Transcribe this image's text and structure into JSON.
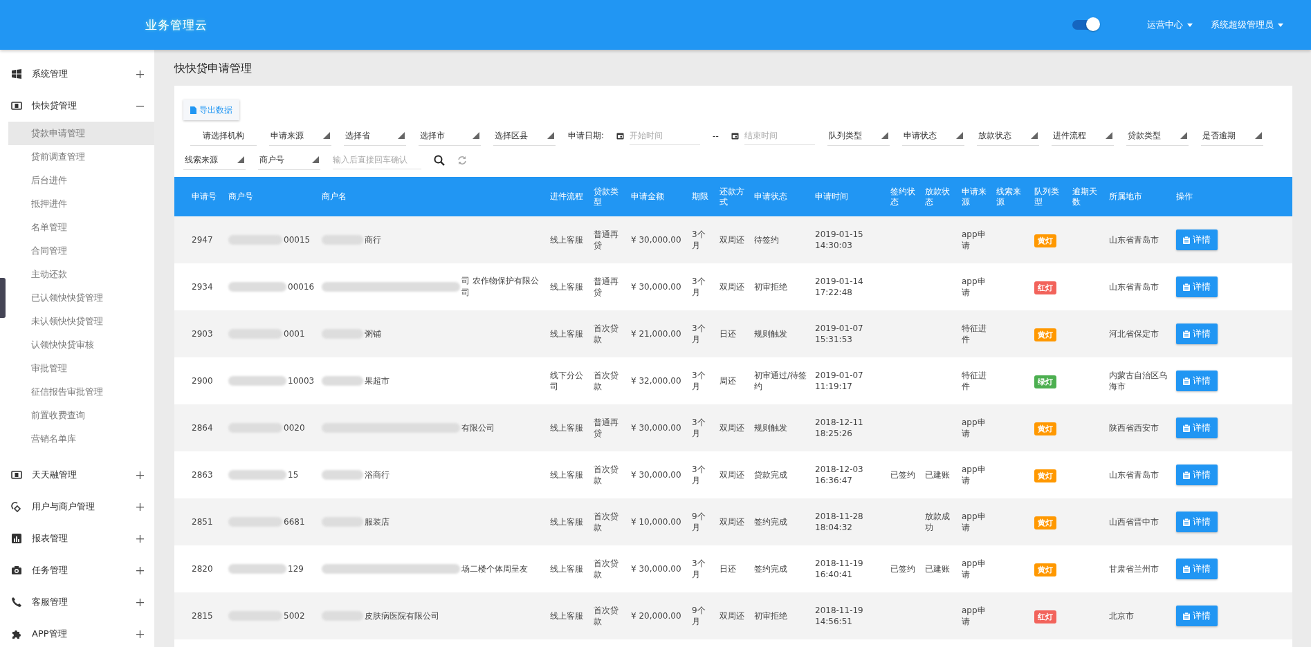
{
  "header": {
    "logo": "业务管理云",
    "toggle": {
      "on": true
    },
    "menus": [
      {
        "label": "运营中心"
      },
      {
        "label": "系统超级管理员"
      }
    ]
  },
  "sidebar": {
    "groups": [
      {
        "label": "系统管理",
        "expanded": false
      },
      {
        "label": "快快贷管理",
        "expanded": true,
        "children": [
          {
            "label": "贷款申请管理",
            "selected": true
          },
          {
            "label": "贷前调查管理",
            "selected": false
          },
          {
            "label": "后台进件",
            "selected": false
          },
          {
            "label": "抵押进件",
            "selected": false
          },
          {
            "label": "名单管理",
            "selected": false
          },
          {
            "label": "合同管理",
            "selected": false
          },
          {
            "label": "主动还款",
            "selected": false
          },
          {
            "label": "已认领快快贷管理",
            "selected": false
          },
          {
            "label": "未认领快快贷管理",
            "selected": false
          },
          {
            "label": "认领快快贷审核",
            "selected": false
          },
          {
            "label": "审批管理",
            "selected": false
          },
          {
            "label": "征信报告审批管理",
            "selected": false
          },
          {
            "label": "前置收费查询",
            "selected": false
          },
          {
            "label": "营销名单库",
            "selected": false
          }
        ]
      },
      {
        "label": "天天融管理",
        "expanded": false
      },
      {
        "label": "用户与商户管理",
        "expanded": false
      },
      {
        "label": "报表管理",
        "expanded": false
      },
      {
        "label": "任务管理",
        "expanded": false
      },
      {
        "label": "客服管理",
        "expanded": false
      },
      {
        "label": "APP管理",
        "expanded": false
      }
    ]
  },
  "page_title": "快快贷申请管理",
  "export_button": "导出数据",
  "filters": [
    {
      "kind": "org",
      "label": "请选择机构"
    },
    {
      "kind": "select",
      "label": "申请来源"
    },
    {
      "kind": "select",
      "label": "选择省"
    },
    {
      "kind": "select",
      "label": "选择市"
    },
    {
      "kind": "select",
      "label": "选择区县"
    },
    {
      "kind": "label",
      "label": "申请日期:"
    },
    {
      "kind": "date",
      "placeholder": "开始时间"
    },
    {
      "kind": "label",
      "label": "--"
    },
    {
      "kind": "date",
      "placeholder": "结束时间"
    },
    {
      "kind": "select",
      "label": "队列类型"
    },
    {
      "kind": "select",
      "label": "申请状态"
    },
    {
      "kind": "select",
      "label": "放款状态"
    },
    {
      "kind": "select",
      "label": "进件流程"
    },
    {
      "kind": "select",
      "label": "贷款类型"
    },
    {
      "kind": "select",
      "label": "是否逾期"
    },
    {
      "kind": "select",
      "label": "线索来源"
    },
    {
      "kind": "select",
      "label": "商户号"
    },
    {
      "kind": "text",
      "placeholder": "输入后直接回车确认"
    },
    {
      "kind": "search"
    },
    {
      "kind": "refresh"
    }
  ],
  "table": {
    "columns": [
      "申请号",
      "商户号",
      "商户名",
      "进件流程",
      "贷款类型",
      "申请金额",
      "期限",
      "还款方式",
      "申请状态",
      "申请时间",
      "签约状态",
      "放款状态",
      "申请来源",
      "线索来源",
      "队列类型",
      "逾期天数",
      "所属地市",
      "操作"
    ],
    "rows": [
      {
        "id": "2947",
        "merchant_no": "00015",
        "merchant_name": "商行",
        "flow": "线上客服",
        "loan_type": "普通再贷",
        "amount": "¥ 30,000.00",
        "term": "3个月",
        "repay": "双周还",
        "status": "待签约",
        "time": "2019-01-15 14:30:03",
        "source": "app申请",
        "queue": {
          "label": "黄灯",
          "color": "#ff9800"
        },
        "city": "山东省青岛市",
        "action": "详情"
      },
      {
        "id": "2934",
        "merchant_no": "00016",
        "merchant_name": "司 农作物保护有限公司",
        "flow": "线上客服",
        "loan_type": "普通再贷",
        "amount": "¥ 30,000.00",
        "term": "3个月",
        "repay": "双周还",
        "status": "初审拒绝",
        "time": "2019-01-14 17:22:48",
        "source": "app申请",
        "queue": {
          "label": "红灯",
          "color": "#f2635b"
        },
        "city": "山东省青岛市",
        "action": "详情"
      },
      {
        "id": "2903",
        "merchant_no": "0001",
        "merchant_name": "粥铺",
        "flow": "线上客服",
        "loan_type": "首次贷款",
        "amount": "¥ 21,000.00",
        "term": "3个月",
        "repay": "日还",
        "status": "规则触发",
        "time": "2019-01-07 15:31:53",
        "source": "特征进件",
        "queue": {
          "label": "黄灯",
          "color": "#ff9800"
        },
        "city": "河北省保定市",
        "action": "详情"
      },
      {
        "id": "2900",
        "merchant_no": "10003",
        "merchant_name": "果超市",
        "flow": "线下分公司",
        "loan_type": "首次贷款",
        "amount": "¥ 32,000.00",
        "term": "3个月",
        "repay": "周还",
        "status": "初审通过/待签约",
        "time": "2019-01-07 11:19:17",
        "source": "特征进件",
        "queue": {
          "label": "绿灯",
          "color": "#4caf50"
        },
        "city": "内蒙古自治区乌海市",
        "action": "详情"
      },
      {
        "id": "2864",
        "merchant_no": "0020",
        "merchant_name": "有限公司",
        "flow": "线上客服",
        "loan_type": "普通再贷",
        "amount": "¥ 30,000.00",
        "term": "3个月",
        "repay": "双周还",
        "status": "规则触发",
        "time": "2018-12-11 18:25:26",
        "source": "app申请",
        "queue": {
          "label": "黄灯",
          "color": "#ff9800"
        },
        "city": "陕西省西安市",
        "action": "详情"
      },
      {
        "id": "2863",
        "merchant_no": "15",
        "merchant_name": "浴商行",
        "flow": "线上客服",
        "loan_type": "首次贷款",
        "amount": "¥ 30,000.00",
        "term": "3个月",
        "repay": "双周还",
        "status": "贷款完成",
        "time": "2018-12-03 16:36:47",
        "sign": "已签约",
        "loan": "已建账",
        "source": "app申请",
        "queue": {
          "label": "黄灯",
          "color": "#ff9800"
        },
        "city": "山东省青岛市",
        "action": "详情"
      },
      {
        "id": "2851",
        "merchant_no": "6681",
        "merchant_name": "服装店",
        "flow": "线上客服",
        "loan_type": "首次贷款",
        "amount": "¥ 10,000.00",
        "term": "9个月",
        "repay": "双周还",
        "status": "签约完成",
        "time": "2018-11-28 18:04:32",
        "loan": "放款成功",
        "source": "app申请",
        "queue": {
          "label": "黄灯",
          "color": "#ff9800"
        },
        "city": "山西省晋中市",
        "action": "详情"
      },
      {
        "id": "2820",
        "merchant_no": "129",
        "merchant_name": "场二楼个体周呈友",
        "flow": "线上客服",
        "loan_type": "首次贷款",
        "amount": "¥ 30,000.00",
        "term": "3个月",
        "repay": "日还",
        "status": "签约完成",
        "time": "2018-11-19 16:40:41",
        "sign": "已签约",
        "loan": "已建账",
        "source": "app申请",
        "queue": {
          "label": "黄灯",
          "color": "#ff9800"
        },
        "city": "甘肃省兰州市",
        "action": "详情"
      },
      {
        "id": "2815",
        "merchant_no": "5002",
        "merchant_name": "皮肤病医院有限公司",
        "flow": "线上客服",
        "loan_type": "首次贷款",
        "amount": "¥ 20,000.00",
        "term": "9个月",
        "repay": "双周还",
        "status": "初审拒绝",
        "time": "2018-11-19 14:56:51",
        "source": "app申请",
        "queue": {
          "label": "红灯",
          "color": "#f2635b"
        },
        "city": "北京市",
        "action": "详情"
      }
    ]
  }
}
